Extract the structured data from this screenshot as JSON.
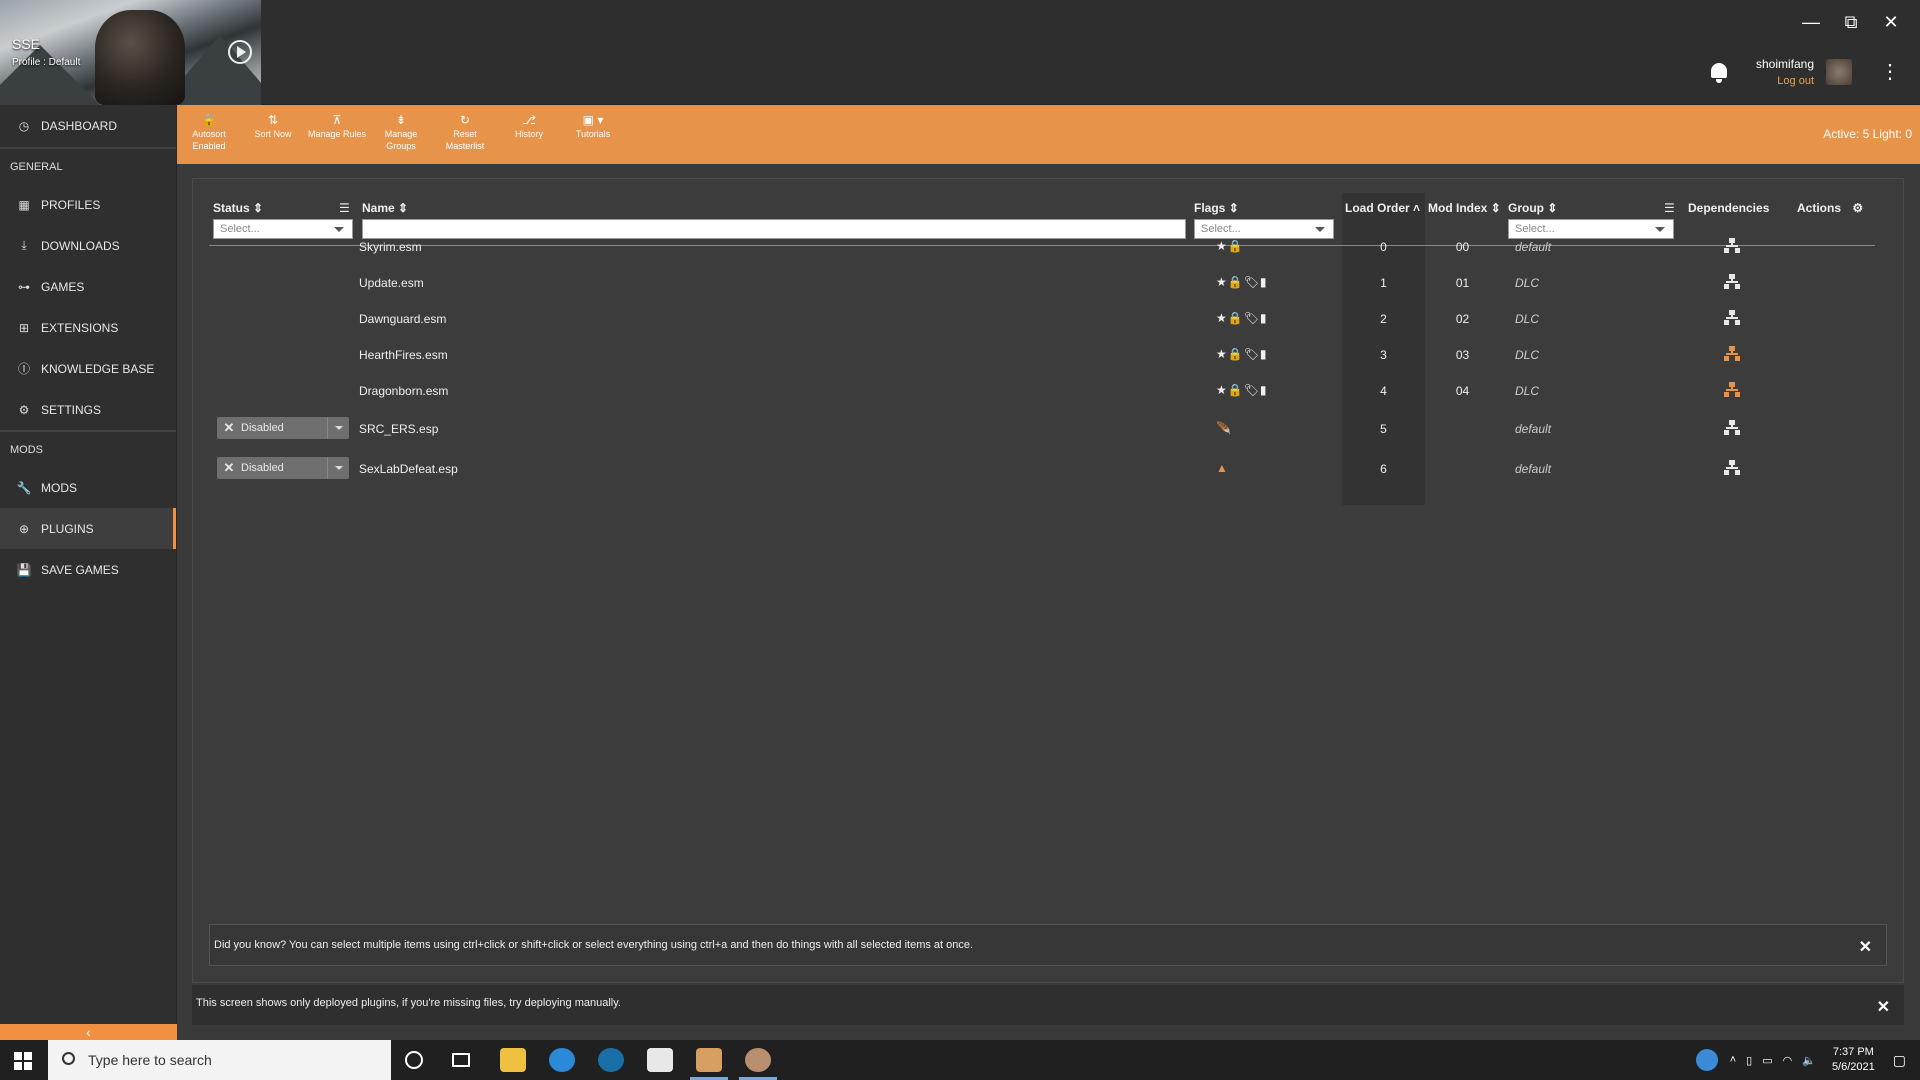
{
  "game": {
    "title": "SSE",
    "profile": "Profile : Default"
  },
  "window_buttons": [
    "—",
    "⧉",
    "✕"
  ],
  "user": {
    "name": "shoimifang",
    "logout": "Log out"
  },
  "sidebar": {
    "dashboard": "DASHBOARD",
    "general_header": "GENERAL",
    "general_items": [
      "PROFILES",
      "DOWNLOADS",
      "GAMES",
      "EXTENSIONS",
      "KNOWLEDGE BASE",
      "SETTINGS"
    ],
    "mods_header": "MODS",
    "mods_items": [
      "MODS",
      "PLUGINS",
      "SAVE GAMES"
    ],
    "collapse": "‹"
  },
  "toolbar": {
    "autosort": "Autosort Enabled",
    "sort_now": "Sort Now",
    "manage_rules": "Manage Rules",
    "manage_groups": "Manage Groups",
    "reset_masterlist": "Reset Masterlist",
    "history": "History",
    "tutorials": "Tutorials",
    "active_count": "Active: 5 Light: 0"
  },
  "columns": {
    "status": "Status",
    "name": "Name",
    "flags": "Flags",
    "load_order": "Load Order",
    "mod_index": "Mod Index",
    "group": "Group",
    "dependencies": "Dependencies",
    "actions": "Actions"
  },
  "filters": {
    "status_placeholder": "Select...",
    "flags_placeholder": "Select...",
    "group_placeholder": "Select..."
  },
  "plugins": [
    {
      "status": "",
      "name": "Skyrim.esm",
      "flags": "★🔒",
      "load_order": "0",
      "mod_index": "00",
      "group": "default",
      "dep_color": "#e8e8e8"
    },
    {
      "status": "",
      "name": "Update.esm",
      "flags": "★🔒🏷▮",
      "load_order": "1",
      "mod_index": "01",
      "group": "DLC",
      "dep_color": "#e8e8e8"
    },
    {
      "status": "",
      "name": "Dawnguard.esm",
      "flags": "★🔒🏷▮",
      "load_order": "2",
      "mod_index": "02",
      "group": "DLC",
      "dep_color": "#e8e8e8"
    },
    {
      "status": "",
      "name": "HearthFires.esm",
      "flags": "★🔒🏷▮",
      "load_order": "3",
      "mod_index": "03",
      "group": "DLC",
      "dep_color": "#e8934a"
    },
    {
      "status": "",
      "name": "Dragonborn.esm",
      "flags": "★🔒🏷▮",
      "load_order": "4",
      "mod_index": "04",
      "group": "DLC",
      "dep_color": "#e8934a"
    },
    {
      "status": "Disabled",
      "name": "SRC_ERS.esp",
      "flags": "🪶",
      "load_order": "5",
      "mod_index": "",
      "group": "default",
      "dep_color": "#e8e8e8"
    },
    {
      "status": "Disabled",
      "name": "SexLabDefeat.esp",
      "flags": "▲",
      "load_order": "6",
      "mod_index": "",
      "group": "default",
      "dep_color": "#e8e8e8"
    }
  ],
  "tip": "Did you know? You can select multiple items using ctrl+click or shift+click or select everything using ctrl+a and then do things with all selected items at once.",
  "footer": "This screen shows only deployed plugins, if you're missing files, try deploying manually.",
  "taskbar": {
    "search_placeholder": "Type here to search",
    "time": "7:37 PM",
    "date": "5/6/2021"
  }
}
